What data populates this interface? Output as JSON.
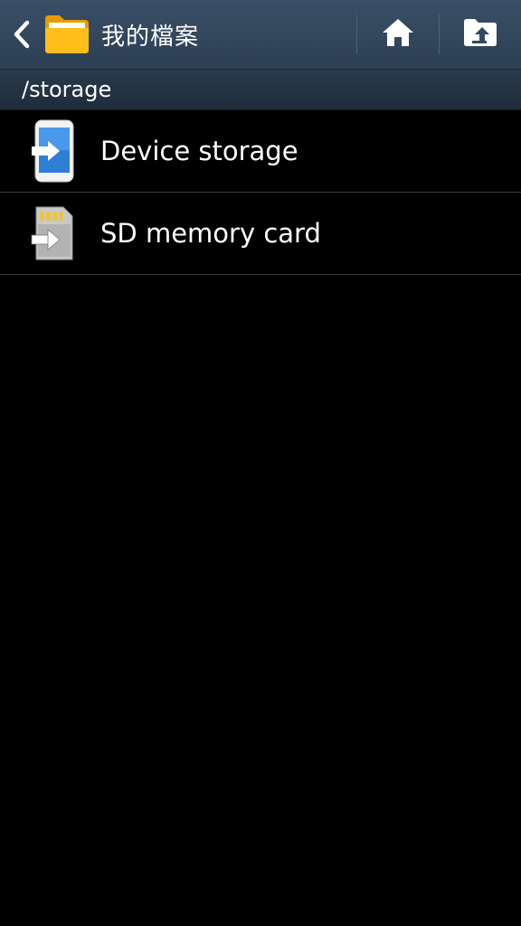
{
  "action_bar": {
    "title": "我的檔案",
    "icons": {
      "back": "chevron-left-icon",
      "app": "folder-icon",
      "home": "home-icon",
      "up": "folder-up-icon"
    }
  },
  "path_bar": {
    "path": "/storage"
  },
  "storage_list": {
    "items": [
      {
        "label": "Device storage",
        "icon": "phone-storage-icon"
      },
      {
        "label": "SD memory card",
        "icon": "sd-card-icon"
      }
    ]
  },
  "colors": {
    "action_bar_bg": "#34495f",
    "path_bar_bg": "#24323f",
    "list_bg": "#000000",
    "divider": "#3a3a3a",
    "folder_yellow": "#f7b500"
  }
}
